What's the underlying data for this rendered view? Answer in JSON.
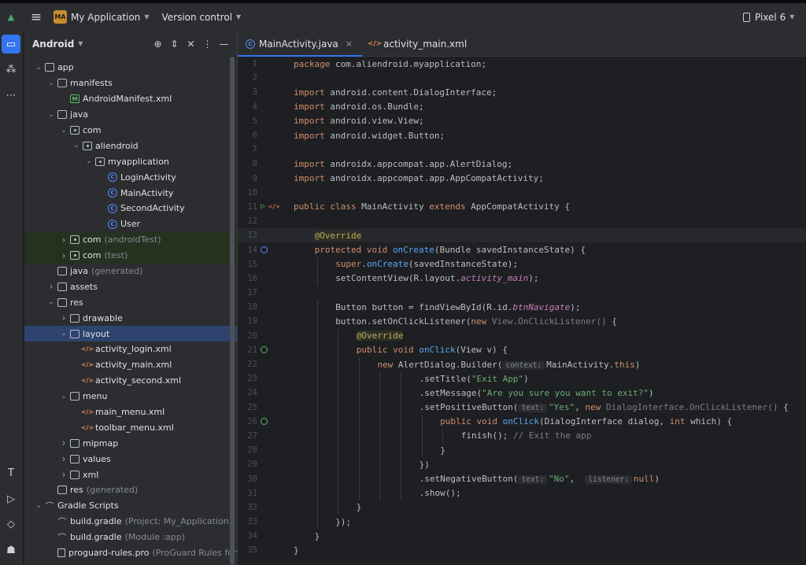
{
  "titlebar": {
    "badge": "MA",
    "project": "My Application",
    "vcs": "Version control",
    "device": "Pixel 6"
  },
  "project_panel": {
    "title": "Android",
    "tree": [
      {
        "label": "app",
        "depth": 0,
        "arrow": "down",
        "icon": "folder-icon"
      },
      {
        "label": "manifests",
        "depth": 1,
        "arrow": "down",
        "icon": "folder-icon"
      },
      {
        "label": "AndroidManifest.xml",
        "depth": 2,
        "arrow": "",
        "icon": "manifest-icon"
      },
      {
        "label": "java",
        "depth": 1,
        "arrow": "down",
        "icon": "folder-icon"
      },
      {
        "label": "com",
        "depth": 2,
        "arrow": "down",
        "icon": "package-icon"
      },
      {
        "label": "aliendroid",
        "depth": 3,
        "arrow": "down",
        "icon": "package-icon"
      },
      {
        "label": "myapplication",
        "depth": 4,
        "arrow": "down",
        "icon": "package-icon"
      },
      {
        "label": "LoginActivity",
        "depth": 5,
        "arrow": "",
        "icon": "class-icon"
      },
      {
        "label": "MainActivity",
        "depth": 5,
        "arrow": "",
        "icon": "class-icon"
      },
      {
        "label": "SecondActivity",
        "depth": 5,
        "arrow": "",
        "icon": "class-icon"
      },
      {
        "label": "User",
        "depth": 5,
        "arrow": "",
        "icon": "class-icon"
      },
      {
        "label": "com",
        "sub": "(androidTest)",
        "depth": 2,
        "arrow": "right",
        "icon": "package-icon",
        "style": "green"
      },
      {
        "label": "com",
        "sub": "(test)",
        "depth": 2,
        "arrow": "right",
        "icon": "package-icon",
        "style": "green"
      },
      {
        "label": "java",
        "sub": "(generated)",
        "depth": 1,
        "arrow": "",
        "icon": "folder-icon"
      },
      {
        "label": "assets",
        "depth": 1,
        "arrow": "right",
        "icon": "folder-icon"
      },
      {
        "label": "res",
        "depth": 1,
        "arrow": "down",
        "icon": "folder-icon"
      },
      {
        "label": "drawable",
        "depth": 2,
        "arrow": "right",
        "icon": "folder-icon"
      },
      {
        "label": "layout",
        "depth": 2,
        "arrow": "down",
        "icon": "folder-icon",
        "style": "sel"
      },
      {
        "label": "activity_login.xml",
        "depth": 3,
        "arrow": "",
        "icon": "xml-icon"
      },
      {
        "label": "activity_main.xml",
        "depth": 3,
        "arrow": "",
        "icon": "xml-icon"
      },
      {
        "label": "activity_second.xml",
        "depth": 3,
        "arrow": "",
        "icon": "xml-icon"
      },
      {
        "label": "menu",
        "depth": 2,
        "arrow": "down",
        "icon": "folder-icon"
      },
      {
        "label": "main_menu.xml",
        "depth": 3,
        "arrow": "",
        "icon": "xml-icon"
      },
      {
        "label": "toolbar_menu.xml",
        "depth": 3,
        "arrow": "",
        "icon": "xml-icon"
      },
      {
        "label": "mipmap",
        "depth": 2,
        "arrow": "right",
        "icon": "folder-icon"
      },
      {
        "label": "values",
        "depth": 2,
        "arrow": "right",
        "icon": "folder-icon"
      },
      {
        "label": "xml",
        "depth": 2,
        "arrow": "right",
        "icon": "folder-icon"
      },
      {
        "label": "res",
        "sub": "(generated)",
        "depth": 1,
        "arrow": "",
        "icon": "folder-icon"
      },
      {
        "label": "Gradle Scripts",
        "depth": 0,
        "arrow": "down",
        "icon": "gradle-icon"
      },
      {
        "label": "build.gradle",
        "sub": "(Project: My_Application)",
        "depth": 1,
        "arrow": "",
        "icon": "gradle-icon"
      },
      {
        "label": "build.gradle",
        "sub": "(Module :app)",
        "depth": 1,
        "arrow": "",
        "icon": "gradle-icon"
      },
      {
        "label": "proguard-rules.pro",
        "sub": "(ProGuard Rules for \"",
        "depth": 1,
        "arrow": "",
        "icon": "file-icon"
      }
    ]
  },
  "editor": {
    "tabs": [
      {
        "label": "MainActivity.java",
        "active": true,
        "icon": "class-icon"
      },
      {
        "label": "activity_main.xml",
        "active": false,
        "icon": "xml-icon"
      }
    ],
    "current_line": 13,
    "lines": [
      {
        "n": "1",
        "indent": 0,
        "tokens": [
          [
            "k",
            "package "
          ],
          [
            "p",
            "com.aliendroid.myapplication;"
          ]
        ]
      },
      {
        "n": "2",
        "indent": 0,
        "tokens": []
      },
      {
        "n": "3",
        "indent": 0,
        "tokens": [
          [
            "k",
            "import "
          ],
          [
            "p",
            "android.content.DialogInterface;"
          ]
        ]
      },
      {
        "n": "4",
        "indent": 0,
        "tokens": [
          [
            "k",
            "import "
          ],
          [
            "p",
            "android.os.Bundle;"
          ]
        ]
      },
      {
        "n": "5",
        "indent": 0,
        "tokens": [
          [
            "k",
            "import "
          ],
          [
            "p",
            "android.view.View;"
          ]
        ]
      },
      {
        "n": "6",
        "indent": 0,
        "tokens": [
          [
            "k",
            "import "
          ],
          [
            "p",
            "android.widget.Button;"
          ]
        ]
      },
      {
        "n": "7",
        "indent": 0,
        "tokens": []
      },
      {
        "n": "8",
        "indent": 0,
        "tokens": [
          [
            "k",
            "import "
          ],
          [
            "p",
            "androidx.appcompat.app.AlertDialog;"
          ]
        ]
      },
      {
        "n": "9",
        "indent": 0,
        "tokens": [
          [
            "k",
            "import "
          ],
          [
            "p",
            "androidx.appcompat.app.AppCompatActivity;"
          ]
        ]
      },
      {
        "n": "10",
        "indent": 0,
        "tokens": []
      },
      {
        "n": "11",
        "indent": 0,
        "gutter": "run",
        "tokens": [
          [
            "k",
            "public class "
          ],
          [
            "p",
            "MainActivity "
          ],
          [
            "k",
            "extends "
          ],
          [
            "p",
            "AppCompatActivity {"
          ]
        ]
      },
      {
        "n": "12",
        "indent": 0,
        "tokens": []
      },
      {
        "n": "13",
        "indent": 1,
        "tokens": [
          [
            "a",
            "@Override"
          ]
        ]
      },
      {
        "n": "14",
        "indent": 1,
        "gutter": "override",
        "tokens": [
          [
            "k",
            "protected void "
          ],
          [
            "f",
            "onCreate"
          ],
          [
            "p",
            "(Bundle savedInstanceState) {"
          ]
        ]
      },
      {
        "n": "15",
        "indent": 2,
        "tokens": [
          [
            "k",
            "super"
          ],
          [
            "p",
            "."
          ],
          [
            "f",
            "onCreate"
          ],
          [
            "p",
            "(savedInstanceState);"
          ]
        ]
      },
      {
        "n": "16",
        "indent": 2,
        "tokens": [
          [
            "p",
            "setContentView(R.layout."
          ],
          [
            "i",
            "activity_main"
          ],
          [
            "p",
            ");"
          ]
        ]
      },
      {
        "n": "17",
        "indent": 0,
        "tokens": []
      },
      {
        "n": "18",
        "indent": 2,
        "tokens": [
          [
            "p",
            "Button button = findViewById(R.id."
          ],
          [
            "i",
            "btnNavigate"
          ],
          [
            "p",
            ");"
          ]
        ]
      },
      {
        "n": "19",
        "indent": 2,
        "tokens": [
          [
            "p",
            "button.setOnClickListener("
          ],
          [
            "k",
            "new "
          ],
          [
            "g",
            "View.OnClickListener() "
          ],
          [
            "p",
            "{"
          ]
        ]
      },
      {
        "n": "20",
        "indent": 3,
        "tokens": [
          [
            "a",
            "@Override"
          ]
        ]
      },
      {
        "n": "21",
        "indent": 3,
        "gutter": "impl",
        "tokens": [
          [
            "k",
            "public void "
          ],
          [
            "f",
            "onClick"
          ],
          [
            "p",
            "(View v) {"
          ]
        ]
      },
      {
        "n": "22",
        "indent": 4,
        "tokens": [
          [
            "k",
            "new "
          ],
          [
            "p",
            "AlertDialog.Builder("
          ],
          [
            "h",
            "context:"
          ],
          [
            "p",
            "MainActivity."
          ],
          [
            "k",
            "this"
          ],
          [
            "p",
            ")"
          ]
        ]
      },
      {
        "n": "23",
        "indent": 6,
        "tokens": [
          [
            "p",
            "."
          ],
          [
            "p",
            "setTitle("
          ],
          [
            "s",
            "\"Exit App\""
          ],
          [
            "p",
            ")"
          ]
        ]
      },
      {
        "n": "24",
        "indent": 6,
        "tokens": [
          [
            "p",
            ".setMessage("
          ],
          [
            "s",
            "\"Are you sure you want to exit?\""
          ],
          [
            "p",
            ")"
          ]
        ]
      },
      {
        "n": "25",
        "indent": 6,
        "tokens": [
          [
            "p",
            ".setPositiveButton("
          ],
          [
            "h",
            "text:"
          ],
          [
            "s",
            "\"Yes\""
          ],
          [
            "p",
            ", "
          ],
          [
            "k",
            "new "
          ],
          [
            "g",
            "DialogInterface.OnClickListener() "
          ],
          [
            "p",
            "{"
          ]
        ]
      },
      {
        "n": "26",
        "indent": 7,
        "gutter": "impl",
        "tokens": [
          [
            "k",
            "public void "
          ],
          [
            "f",
            "onClick"
          ],
          [
            "p",
            "(DialogInterface dialog, "
          ],
          [
            "k",
            "int "
          ],
          [
            "p",
            "which) {"
          ]
        ]
      },
      {
        "n": "27",
        "indent": 8,
        "tokens": [
          [
            "p",
            "finish(); "
          ],
          [
            "g",
            "// Exit the app"
          ]
        ]
      },
      {
        "n": "28",
        "indent": 7,
        "tokens": [
          [
            "p",
            "}"
          ]
        ]
      },
      {
        "n": "29",
        "indent": 6,
        "tokens": [
          [
            "p",
            "})"
          ]
        ]
      },
      {
        "n": "30",
        "indent": 6,
        "tokens": [
          [
            "p",
            ".setNegativeButton("
          ],
          [
            "h",
            "text:"
          ],
          [
            "s",
            "\"No\""
          ],
          [
            "p",
            ",  "
          ],
          [
            "h",
            "listener:"
          ],
          [
            "k",
            "null"
          ],
          [
            "p",
            ")"
          ]
        ]
      },
      {
        "n": "31",
        "indent": 6,
        "tokens": [
          [
            "p",
            ".show();"
          ]
        ]
      },
      {
        "n": "32",
        "indent": 3,
        "tokens": [
          [
            "p",
            "}"
          ]
        ]
      },
      {
        "n": "33",
        "indent": 2,
        "tokens": [
          [
            "p",
            "});"
          ]
        ]
      },
      {
        "n": "34",
        "indent": 1,
        "tokens": [
          [
            "p",
            "}"
          ]
        ]
      },
      {
        "n": "35",
        "indent": 0,
        "tokens": [
          [
            "p",
            "}"
          ]
        ]
      }
    ]
  },
  "colors": {
    "accent": "#3574f0",
    "keyword": "#cf8e6d",
    "function": "#56a8f5",
    "string": "#6aab73",
    "annotation": "#b3ae60"
  }
}
